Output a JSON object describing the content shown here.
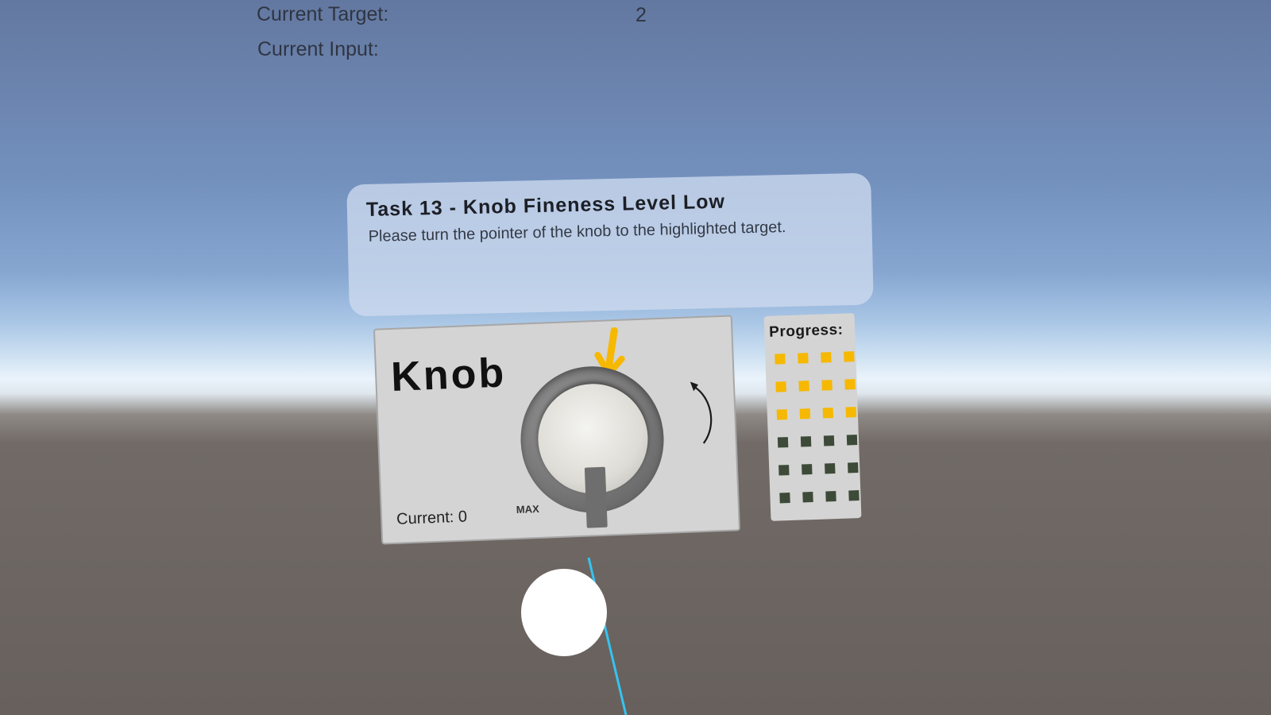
{
  "hud": {
    "target_label": "Current Target:",
    "target_value": "2",
    "input_label": "Current Input:"
  },
  "task": {
    "title": "Task 13 - Knob Fineness Level Low",
    "description": "Please turn the pointer of the knob to the highlighted target."
  },
  "knob": {
    "title": "Knob",
    "current_text": "Current: 0",
    "max_label": "MAX",
    "target_arrow_icon": "arrow-down-icon",
    "rotate_icon": "rotate-counterclockwise-icon"
  },
  "progress": {
    "title": "Progress:",
    "completed": 12,
    "total": 24,
    "columns": 4,
    "completed_color": "#f6b800",
    "pending_color": "#3d4a38"
  },
  "colors": {
    "accent": "#f6b800",
    "laser": "#35c3f0"
  }
}
